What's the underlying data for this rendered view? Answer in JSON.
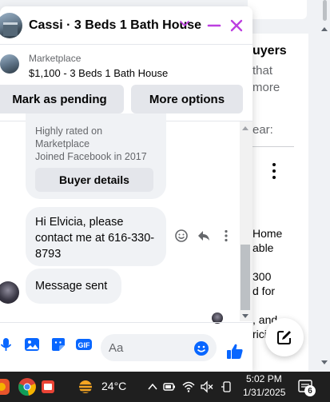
{
  "background": {
    "heading": "uyers",
    "line1": "that",
    "line2": "more",
    "line3": "ear:",
    "line4": "Home",
    "line5": "able",
    "line6": "300",
    "line7": "d for",
    "line8": ", and",
    "line9": "rici"
  },
  "chat": {
    "title": "Cassi · 3 Beds 1 Bath House",
    "listing_source": "Marketplace",
    "listing_title": "$1,100 - 3 Beds 1 Bath House",
    "mark_pending_label": "Mark as pending",
    "more_options_label": "More options",
    "card_line1": "Highly rated on",
    "card_line2": "Marketplace",
    "card_line3": "Joined Facebook in 2017",
    "buyer_details_label": "Buyer details",
    "message_text": "Hi Elvicia, please contact me at 616-330-8793",
    "message_sent_text": "Message sent",
    "composer_placeholder": "Aa"
  },
  "taskbar": {
    "temperature": "24°C",
    "time": "5:02 PM",
    "date": "1/31/2025",
    "notification_count": "6"
  },
  "colors": {
    "accent": "#bc3fe0",
    "primary_blue": "#0866ff",
    "bubble_bg": "#f0f2f5",
    "taskbar_bg": "#1f1f1f"
  },
  "icons": [
    "chevron-down-icon",
    "minimize-icon",
    "close-icon",
    "emoji-react-icon",
    "reply-icon",
    "more-vert-icon",
    "mic-icon",
    "photo-icon",
    "sticker-icon",
    "gif-icon",
    "emoji-icon",
    "like-icon",
    "compose-icon",
    "weather-icon",
    "wifi-icon",
    "battery-icon",
    "volume-muted-icon",
    "notification-icon"
  ]
}
